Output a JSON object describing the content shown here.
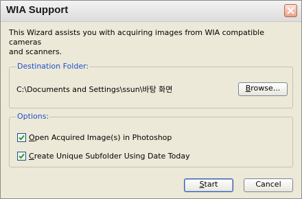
{
  "window": {
    "title": "WIA Support",
    "close_icon": "close-icon"
  },
  "intro": {
    "text": "This Wizard assists you with acquiring images from WIA compatible cameras\n and scanners."
  },
  "destination": {
    "legend": "Destination Folder:",
    "path": "C:\\Documents and Settings\\ssun\\바탕 화면",
    "browse_label_prefix": "B",
    "browse_label_rest": "rowse...",
    "legend_color": "#1f4fc8"
  },
  "options": {
    "legend": "Options:",
    "items": [
      {
        "label_prefix": "O",
        "label_rest": "pen Acquired Image(s) in Photoshop",
        "checked": true
      },
      {
        "label_prefix": "C",
        "label_rest": "reate Unique Subfolder Using Date Today",
        "checked": true
      }
    ]
  },
  "footer": {
    "start_prefix": "S",
    "start_rest": "tart",
    "cancel_label": "Cancel"
  }
}
